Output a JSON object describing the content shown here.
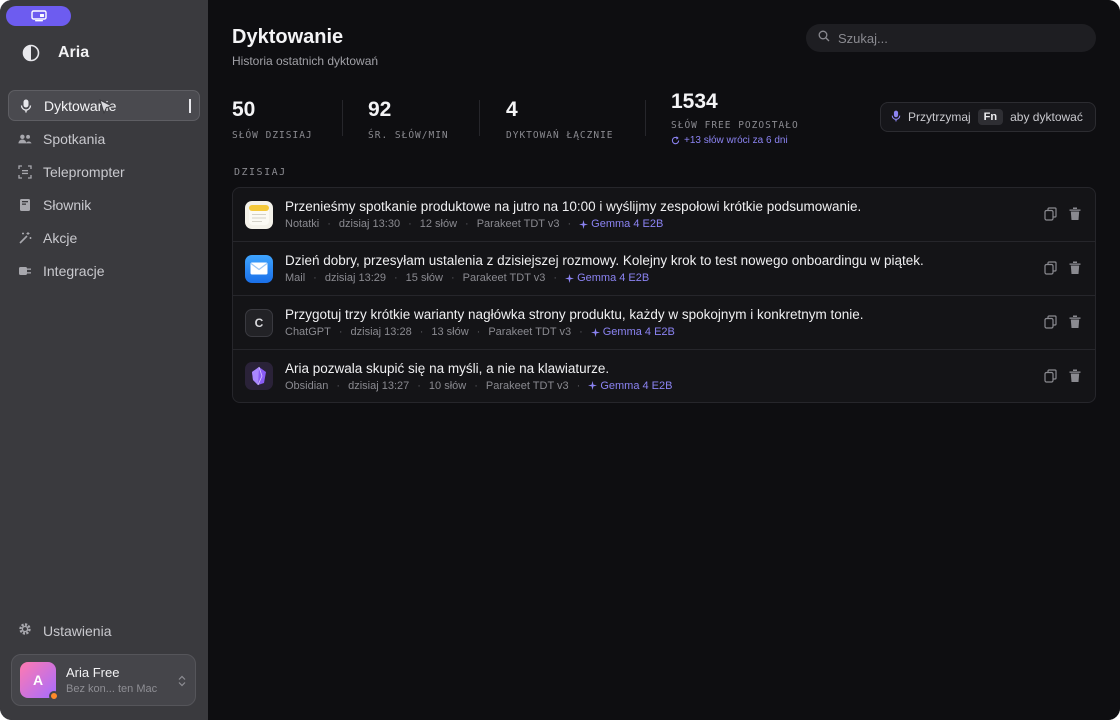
{
  "colors": {
    "accent": "#6d5cf0",
    "model": "#8b83f2",
    "sidebar": "#3a3a3e",
    "main": "#0e0e11"
  },
  "sidebar": {
    "brand": "Aria",
    "items": [
      {
        "label": "Dyktowanie",
        "icon": "microphone-icon",
        "active": true
      },
      {
        "label": "Spotkania",
        "icon": "people-icon"
      },
      {
        "label": "Teleprompter",
        "icon": "teleprompter-icon"
      },
      {
        "label": "Słownik",
        "icon": "book-icon"
      },
      {
        "label": "Akcje",
        "icon": "magic-wand-icon"
      },
      {
        "label": "Integracje",
        "icon": "plug-icon"
      }
    ],
    "settings": "Ustawienia",
    "account": {
      "initial": "A",
      "name": "Aria Free",
      "sub": "Bez kon... ten Mac"
    }
  },
  "header": {
    "title": "Dyktowanie",
    "subtitle": "Historia ostatnich dyktowań",
    "search_placeholder": "Szukaj..."
  },
  "stats": [
    {
      "value": "50",
      "label": "SŁÓW DZISIAJ"
    },
    {
      "value": "92",
      "label": "ŚR. SŁÓW/MIN"
    },
    {
      "value": "4",
      "label": "DYKTOWAŃ ŁĄCZNIE"
    },
    {
      "value": "1534",
      "label": "SŁÓW FREE POZOSTAŁO",
      "note": "+13 słów wróci za 6 dni"
    }
  ],
  "hold": {
    "prefix": "Przytrzymaj",
    "key": "Fn",
    "suffix": "aby dyktować"
  },
  "section": "DZISIAJ",
  "entries": [
    {
      "text": "Przenieśmy spotkanie produktowe na jutro na 10:00 i wyślijmy zespołowi krótkie podsumowanie.",
      "app": "Notatki",
      "time": "dzisiaj 13:30",
      "words": "12 słów",
      "engine": "Parakeet TDT v3",
      "model": "Gemma 4 E2B",
      "icon": "notes-icon"
    },
    {
      "text": "Dzień dobry, przesyłam ustalenia z dzisiejszej rozmowy. Kolejny krok to test nowego onboardingu w piątek.",
      "app": "Mail",
      "time": "dzisiaj 13:29",
      "words": "15 słów",
      "engine": "Parakeet TDT v3",
      "model": "Gemma 4 E2B",
      "icon": "mail-icon"
    },
    {
      "text": "Przygotuj trzy krótkie warianty nagłówka strony produktu, każdy w spokojnym i konkretnym tonie.",
      "app": "ChatGPT",
      "time": "dzisiaj 13:28",
      "words": "13 słów",
      "engine": "Parakeet TDT v3",
      "model": "Gemma 4 E2B",
      "icon": "chatgpt-icon",
      "glyph": "C"
    },
    {
      "text": "Aria pozwala skupić się na myśli, a nie na klawiaturze.",
      "app": "Obsidian",
      "time": "dzisiaj 13:27",
      "words": "10 słów",
      "engine": "Parakeet TDT v3",
      "model": "Gemma 4 E2B",
      "icon": "obsidian-icon"
    }
  ]
}
